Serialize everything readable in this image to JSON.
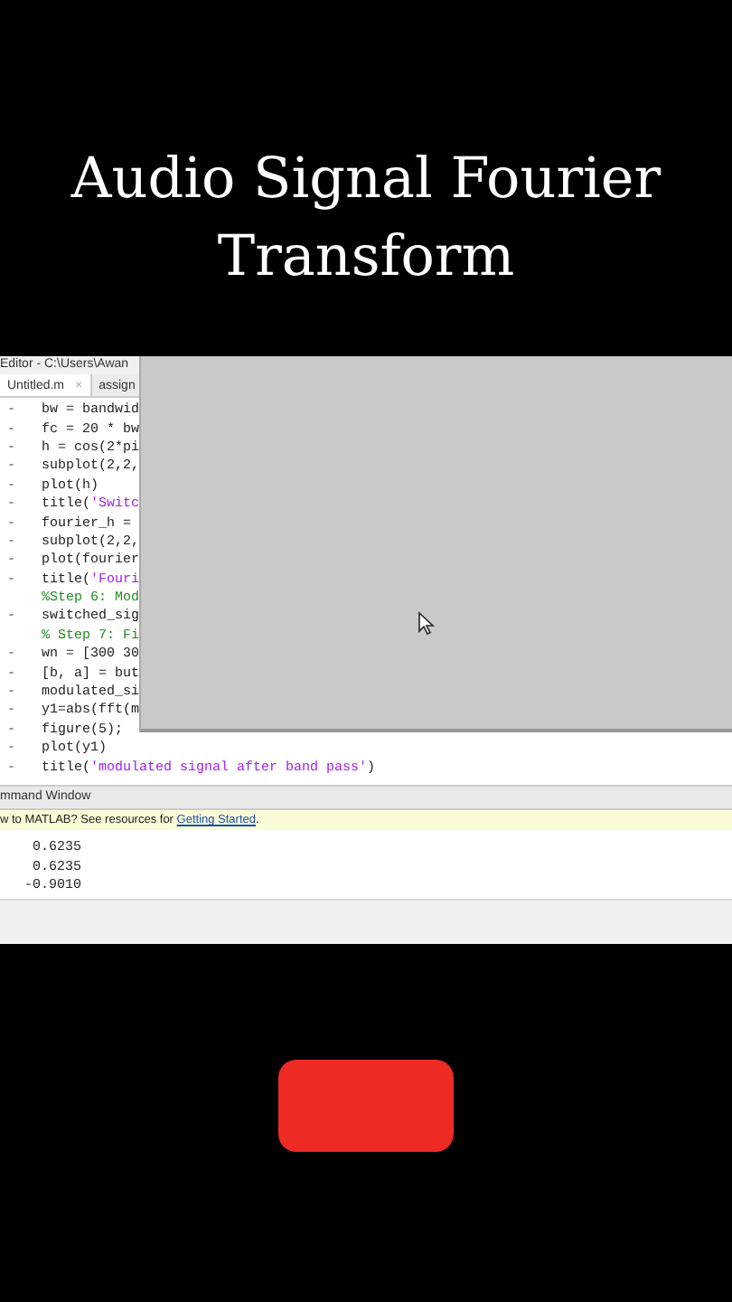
{
  "title_lines": [
    "Audio Signal Fourier",
    "Transform"
  ],
  "editor": {
    "title": "Editor - C:\\Users\\Awan",
    "tabs": [
      {
        "label": "Untitled.m",
        "close": "×",
        "selected": true
      },
      {
        "label": "assign",
        "selected": false
      }
    ],
    "lines": [
      {
        "gutter": "-",
        "segments": [
          {
            "text": "bw = bandwid",
            "kind": "code"
          }
        ]
      },
      {
        "gutter": "-",
        "segments": [
          {
            "text": "fc = 20 * bw",
            "kind": "code"
          }
        ]
      },
      {
        "gutter": "-",
        "segments": [
          {
            "text": "h = cos(2*pi",
            "kind": "code"
          }
        ]
      },
      {
        "gutter": "-",
        "segments": [
          {
            "text": "subplot(2,2,",
            "kind": "code"
          }
        ]
      },
      {
        "gutter": "-",
        "segments": [
          {
            "text": "plot(h)",
            "kind": "code"
          }
        ]
      },
      {
        "gutter": "-",
        "segments": [
          {
            "text": "title(",
            "kind": "code"
          },
          {
            "text": "'Switc",
            "kind": "string"
          }
        ]
      },
      {
        "gutter": "-",
        "segments": [
          {
            "text": "fourier_h =",
            "kind": "code"
          }
        ]
      },
      {
        "gutter": "-",
        "segments": [
          {
            "text": "subplot(2,2,",
            "kind": "code"
          }
        ]
      },
      {
        "gutter": "-",
        "segments": [
          {
            "text": "plot(fourier",
            "kind": "code"
          }
        ]
      },
      {
        "gutter": "-",
        "segments": [
          {
            "text": "title(",
            "kind": "code"
          },
          {
            "text": "'Fouri",
            "kind": "string"
          }
        ]
      },
      {
        "segments": [
          {
            "text": "%Step 6: Mod",
            "kind": "comment"
          }
        ]
      },
      {
        "gutter": "-",
        "segments": [
          {
            "text": "switched_sig",
            "kind": "code"
          }
        ]
      },
      {
        "segments": [
          {
            "text": "% Step 7: Fi",
            "kind": "comment"
          }
        ]
      },
      {
        "gutter": "-",
        "segments": [
          {
            "text": "wn = [300 30",
            "kind": "code"
          }
        ]
      },
      {
        "gutter": "-",
        "segments": [
          {
            "text": "[b, a] = but",
            "kind": "code"
          }
        ]
      },
      {
        "gutter": "-",
        "segments": [
          {
            "text": "modulated_si",
            "kind": "code"
          }
        ]
      },
      {
        "gutter": "-",
        "segments": [
          {
            "text": "y1=abs(fft(m",
            "kind": "code"
          }
        ]
      },
      {
        "gutter": "-",
        "segments": [
          {
            "text": "figure(5);",
            "kind": "code"
          }
        ]
      },
      {
        "gutter": "-",
        "segments": [
          {
            "text": "plot(y1)",
            "kind": "code"
          }
        ]
      },
      {
        "gutter": "-",
        "segments": [
          {
            "text": "title(",
            "kind": "code"
          },
          {
            "text": "'modulated signal after band pass'",
            "kind": "string"
          },
          {
            "text": ")",
            "kind": "code"
          }
        ]
      }
    ]
  },
  "command_window": {
    "title": "mmand Window",
    "notice": "w to MATLAB? See resources for ",
    "notice_link": "Getting Started",
    "notice_end": ".",
    "output": [
      "0.6235",
      "0.6235",
      "-0.9010"
    ]
  }
}
